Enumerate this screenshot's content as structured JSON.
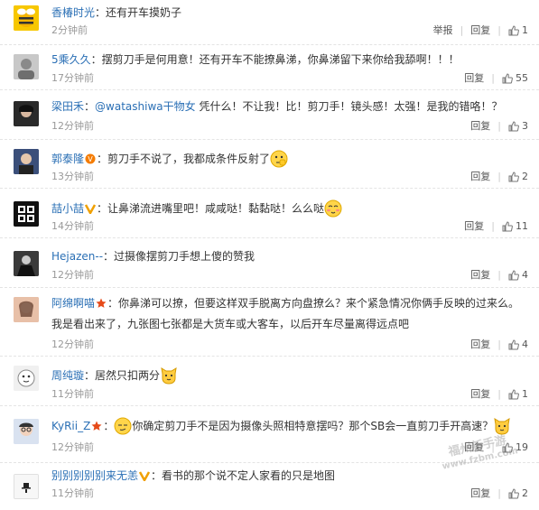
{
  "comments": [
    {
      "user": "香椿时光",
      "text": "：还有开车摸奶子",
      "time": "2分钟前",
      "report": "举报",
      "reply": "回复",
      "likes": "1"
    },
    {
      "user": "5乘久久",
      "text": "：摆剪刀手是何用意！还有开车不能撩鼻涕，你鼻涕留下来你给我舔啊！！！",
      "time": "17分钟前",
      "reply": "回复",
      "likes": "55"
    },
    {
      "user": "梁田禾",
      "text_pre": "：",
      "mention": "@watashiwa干物女",
      "text": " 凭什么！不让我！比！剪刀手！镜头感！太强！是我的错咯！？",
      "time": "12分钟前",
      "reply": "回复",
      "likes": "3"
    },
    {
      "user": "郭泰隆",
      "text": "：剪刀手不说了，我都成条件反射了",
      "time": "13分钟前",
      "reply": "回复",
      "likes": "2"
    },
    {
      "user": "喆小喆",
      "text": "：让鼻涕流进嘴里吧！咸咸哒！黏黏哒！么么哒",
      "time": "14分钟前",
      "reply": "回复",
      "likes": "11"
    },
    {
      "user": "Hejazen--",
      "text": "：过摄像摆剪刀手想上傻的赞我",
      "time": "12分钟前",
      "reply": "回复",
      "likes": "4"
    },
    {
      "user": "阿绵啊喵",
      "text": "：你鼻涕可以撩，但要这样双手脱离方向盘撩么？来个紧急情况你俩手反映的过来么。",
      "text2": "我是看出来了，九张图七张都是大货车或大客车，以后开车尽量离得远点吧",
      "time": "12分钟前",
      "reply": "回复",
      "likes": "4"
    },
    {
      "user": "周纯璇",
      "text": "：居然只扣两分",
      "time": "11分钟前",
      "reply": "回复",
      "likes": "1"
    },
    {
      "user": "KyRii_Z",
      "text_pre": "：",
      "text": "你确定剪刀手不是因为摄像头照相特意摆吗？那个SB会一直剪刀手开高速？",
      "time": "12分钟前",
      "reply": "回复",
      "likes": "19"
    },
    {
      "user": "别别别别别来无恙",
      "text": "：看书的那个说不定人家看的只是地图",
      "time": "11分钟前",
      "reply": "回复",
      "likes": "2"
    }
  ],
  "watermark": {
    "line1": "福州新手游",
    "line2": "www.fzbm.com"
  },
  "colors": {
    "link": "#2a6fb5",
    "vip": "#f0a000",
    "star": "#e64a19"
  }
}
